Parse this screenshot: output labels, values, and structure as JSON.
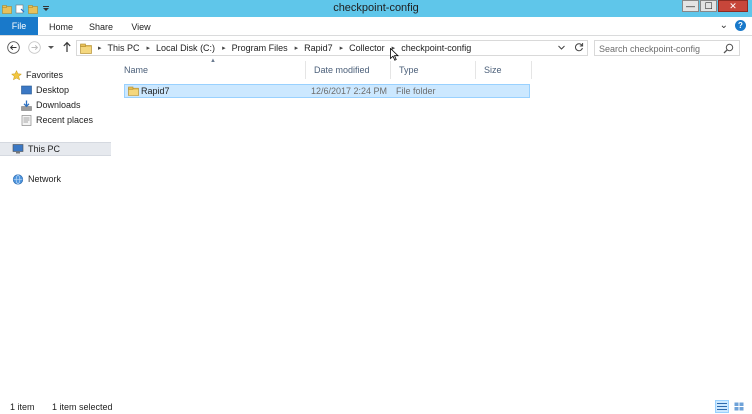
{
  "window": {
    "title": "checkpoint-config",
    "controls": {
      "minimize": "—",
      "maximize": "☐",
      "close": "✕"
    }
  },
  "ribbon": {
    "tabs": [
      {
        "label": "File",
        "active": true
      },
      {
        "label": "Home"
      },
      {
        "label": "Share"
      },
      {
        "label": "View"
      }
    ],
    "expand": "⌄",
    "help": "?"
  },
  "nav": {
    "back": "←",
    "forward": "→",
    "recent": "▾",
    "up": "↑"
  },
  "address": {
    "crumbs": [
      "This PC",
      "Local Disk (C:)",
      "Program Files",
      "Rapid7",
      "Collector",
      "checkpoint-config"
    ],
    "separator": "▸"
  },
  "search": {
    "placeholder": "Search checkpoint-config"
  },
  "sidebar": {
    "favorites": "Favorites",
    "favorites_items": [
      {
        "label": "Desktop"
      },
      {
        "label": "Downloads"
      },
      {
        "label": "Recent places"
      }
    ],
    "this_pc": "This PC",
    "network": "Network"
  },
  "columns": {
    "name": "Name",
    "date": "Date modified",
    "type": "Type",
    "size": "Size"
  },
  "files": [
    {
      "name": "Rapid7",
      "date": "12/6/2017 2:24 PM",
      "type": "File folder",
      "size": ""
    }
  ],
  "status": {
    "count": "1 item",
    "selected": "1 item selected"
  },
  "colors": {
    "titlebar": "#5fc6ea",
    "file_tab": "#1979ca",
    "selection": "#cce8ff",
    "folder": "#e8c15a"
  }
}
